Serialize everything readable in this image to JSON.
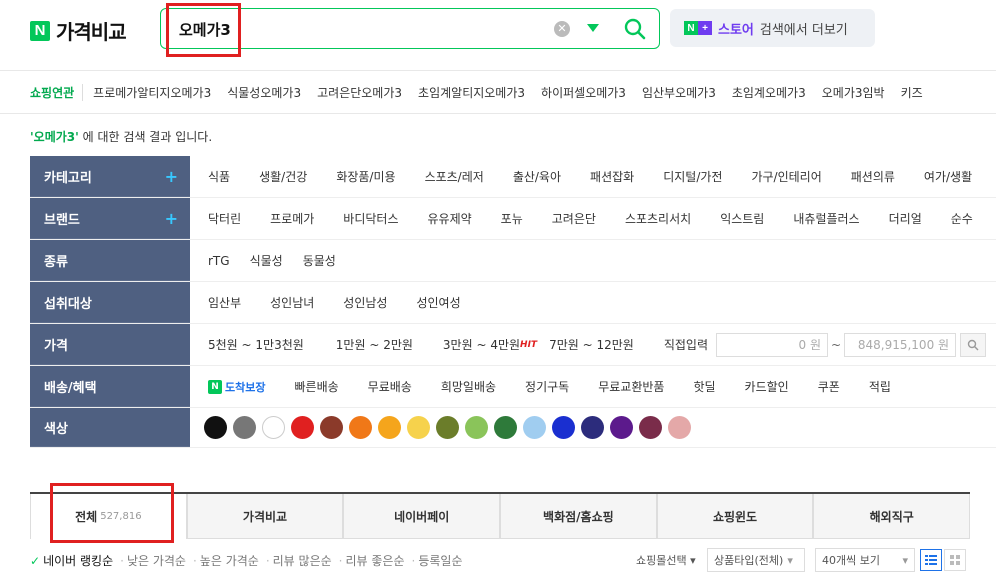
{
  "logo": {
    "badge": "N",
    "text": "가격비교"
  },
  "search": {
    "value": "오메가3"
  },
  "store": {
    "badge_n": "N",
    "badge_plus": "+",
    "brand": "스토어",
    "suffix": "검색에서 더보기"
  },
  "related": {
    "title": "쇼핑연관",
    "items": [
      "프로메가알티지오메가3",
      "식물성오메가3",
      "고려은단오메가3",
      "초임계알티지오메가3",
      "하이퍼셀오메가3",
      "임산부오메가3",
      "초임계오메가3",
      "오메가3임박",
      "키즈"
    ]
  },
  "result": {
    "query": "'오메가3'",
    "suffix": "에 대한 검색 결과 입니다."
  },
  "filters": {
    "category": {
      "label": "카테고리",
      "items": [
        "식품",
        "생활/건강",
        "화장품/미용",
        "스포츠/레저",
        "출산/육아",
        "패션잡화",
        "디지털/가전",
        "가구/인테리어",
        "패션의류",
        "여가/생활"
      ]
    },
    "brand": {
      "label": "브랜드",
      "items": [
        "닥터린",
        "프로메가",
        "바디닥터스",
        "유유제약",
        "포뉴",
        "고려은단",
        "스포츠리서치",
        "익스트림",
        "내츄럴플러스",
        "더리얼",
        "순수"
      ]
    },
    "type": {
      "label": "종류",
      "items": [
        "rTG",
        "식물성",
        "동물성"
      ]
    },
    "target": {
      "label": "섭취대상",
      "items": [
        "임산부",
        "성인남녀",
        "성인남성",
        "성인여성"
      ]
    },
    "price": {
      "label": "가격",
      "ranges": [
        "5천원 ~ 1만3천원",
        "1만원 ~ 2만원",
        "3만원 ~ 4만원",
        "7만원 ~ 12만원"
      ],
      "hit": "HIT",
      "direct": "직접입력",
      "min_placeholder": "0 원",
      "tilde": "~",
      "max_placeholder": "848,915,100 원"
    },
    "delivery": {
      "label": "배송/혜택",
      "badge_n": "N",
      "badge_text": "도착보장",
      "items": [
        "빠른배송",
        "무료배송",
        "희망일배송",
        "정기구독",
        "무료교환반품",
        "핫딜",
        "카드할인",
        "쿠폰",
        "적립"
      ]
    },
    "color": {
      "label": "색상",
      "swatches": [
        "#111111",
        "#777777",
        "#ffffff",
        "#e02020",
        "#8b3a2a",
        "#f07818",
        "#f5a51c",
        "#f6d24c",
        "#6b7d2a",
        "#8ac45a",
        "#2e7a3a",
        "#a0cdf0",
        "#1a2fd0",
        "#2c2c7c",
        "#5c1a8c",
        "#7a2c4a",
        "#e4a8a8"
      ]
    }
  },
  "tabs": [
    {
      "label": "전체",
      "count": "527,816"
    },
    {
      "label": "가격비교"
    },
    {
      "label": "네이버페이"
    },
    {
      "label": "백화점/홈쇼핑"
    },
    {
      "label": "쇼핑윈도"
    },
    {
      "label": "해외직구"
    }
  ],
  "sort": {
    "active": "네이버 랭킹순",
    "items": [
      "낮은 가격순",
      "높은 가격순",
      "리뷰 많은순",
      "리뷰 좋은순",
      "등록일순"
    ],
    "mall_select": "쇼핑몰선택",
    "product_type": "상품타입(전체)",
    "per_page": "40개씩 보기"
  }
}
